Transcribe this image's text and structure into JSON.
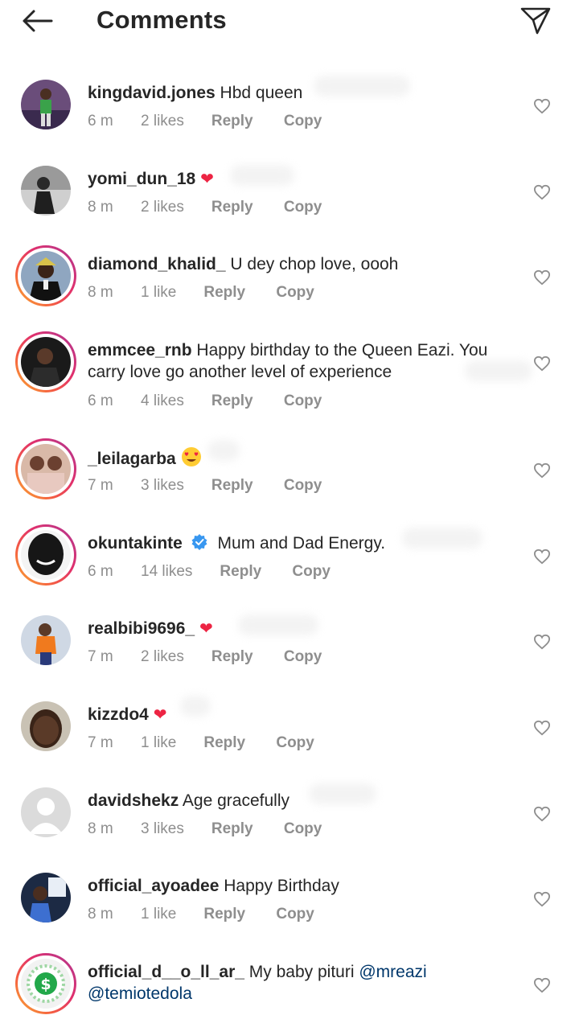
{
  "header": {
    "title": "Comments"
  },
  "colors": {
    "link": "#00376b",
    "muted": "#8e8e8e",
    "heart": "#ed2443",
    "verified": "#3897f0"
  },
  "labels": {
    "reply": "Reply",
    "copy": "Copy"
  },
  "comments": [
    {
      "username": "kingdavid.jones",
      "text": "Hbd queen",
      "time": "6 m",
      "likes": "2 likes",
      "story_ring": false
    },
    {
      "username": "yomi_dun_18",
      "text": "",
      "emoji": "red-heart",
      "time": "8 m",
      "likes": "2 likes",
      "story_ring": false
    },
    {
      "username": "diamond_khalid_",
      "text": "U dey chop love, oooh",
      "time": "8 m",
      "likes": "1 like",
      "story_ring": true
    },
    {
      "username": "emmcee_rnb",
      "text": "Happy birthday to the Queen Eazi. You carry love go another level of experience",
      "time": "6 m",
      "likes": "4 likes",
      "story_ring": true
    },
    {
      "username": "_leilagarba",
      "text": "",
      "emoji": "heart-eyes",
      "time": "7 m",
      "likes": "3 likes",
      "story_ring": true
    },
    {
      "username": "okuntakinte",
      "verified": true,
      "text": "Mum and Dad Energy.",
      "time": "6 m",
      "likes": "14 likes",
      "story_ring": true
    },
    {
      "username": "realbibi9696_",
      "text": "",
      "emoji": "red-heart",
      "time": "7 m",
      "likes": "2 likes",
      "story_ring": false
    },
    {
      "username": "kizzdo4",
      "text": "",
      "emoji": "red-heart",
      "time": "7 m",
      "likes": "1 like",
      "story_ring": false
    },
    {
      "username": "davidshekz",
      "text": "Age gracefully",
      "time": "8 m",
      "likes": "3 likes",
      "story_ring": false
    },
    {
      "username": "official_ayoadee",
      "text": "Happy Birthday",
      "time": "8 m",
      "likes": "1 like",
      "story_ring": false
    },
    {
      "username": "official_d__o_ll_ar_",
      "text": "My baby pituri",
      "mentions": [
        "@mreazi",
        "@temiotedola"
      ],
      "story_ring": true
    }
  ]
}
